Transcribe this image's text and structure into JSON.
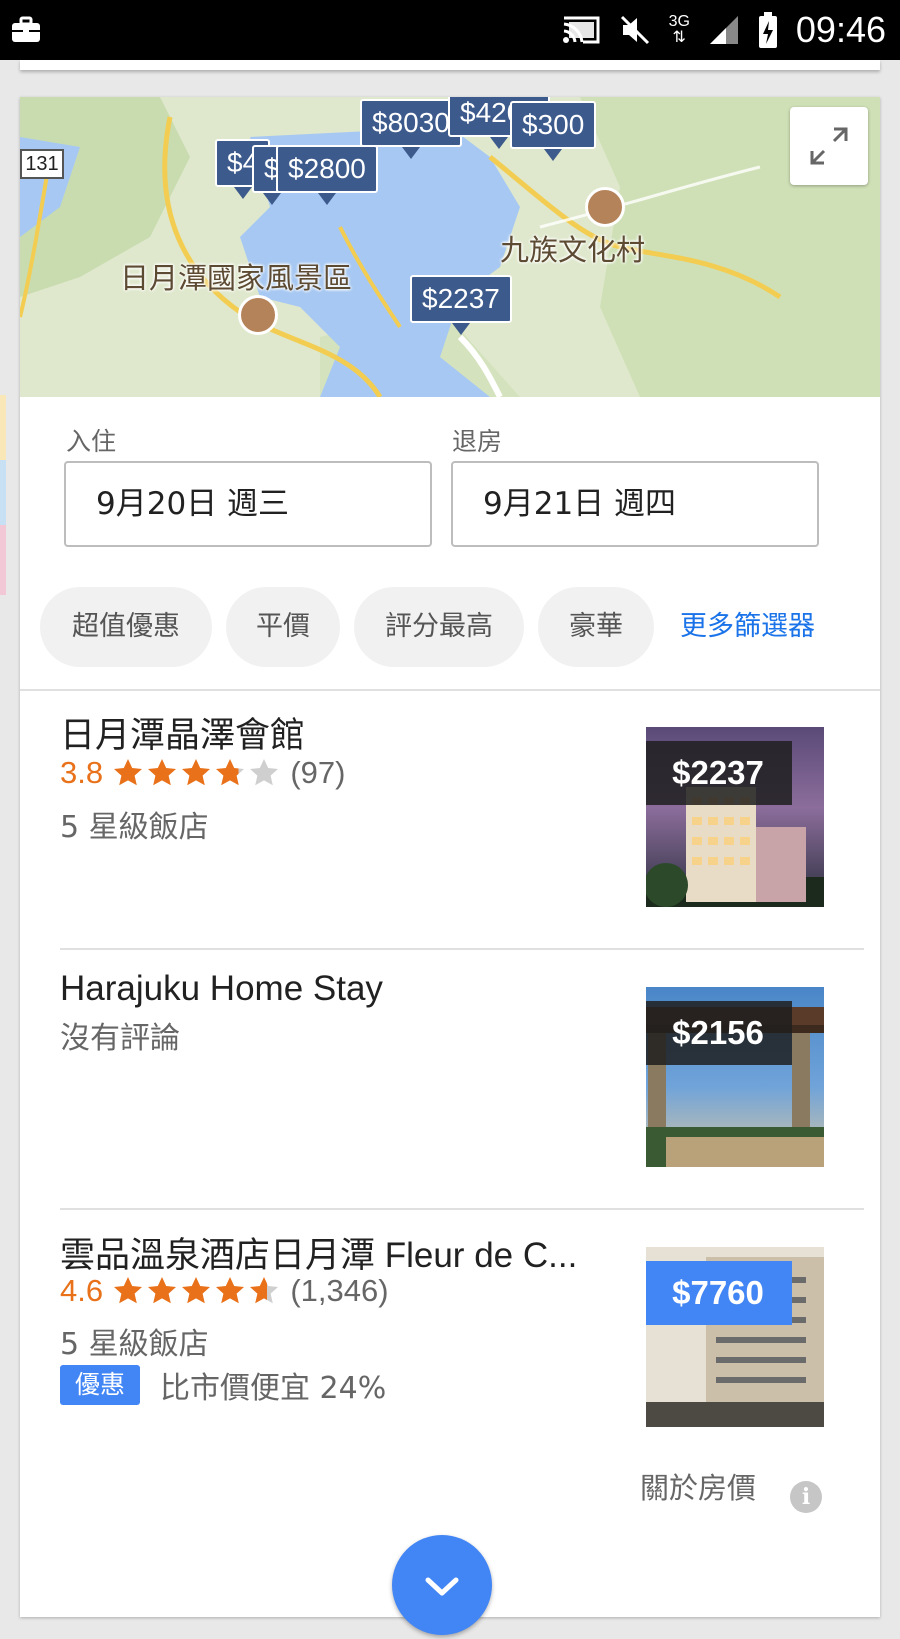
{
  "status_bar": {
    "time": "09:46",
    "network": "3G",
    "icons": [
      "briefcase-icon",
      "cast-icon",
      "mute-icon",
      "signal-icon",
      "battery-charging-icon"
    ]
  },
  "map": {
    "road_number": "131",
    "labels": {
      "park": "日月潭國家風景區",
      "village": "九族文化村"
    },
    "pins": [
      "$8030",
      "$4200",
      "$300",
      "$4",
      "$",
      "$2800",
      "$2237"
    ],
    "expand_icon": "expand-icon"
  },
  "dates": {
    "checkin_label": "入住",
    "checkin_value": "9月20日 週三",
    "checkout_label": "退房",
    "checkout_value": "9月21日 週四"
  },
  "filters": {
    "chips": [
      "超值優惠",
      "平價",
      "評分最高",
      "豪華"
    ],
    "more": "更多篩選器"
  },
  "hotels": [
    {
      "name": "日月潭晶澤會館",
      "rating": "3.8",
      "stars": 3.8,
      "reviews": "(97)",
      "class": "5 星級飯店",
      "price": "$2237",
      "deal": false
    },
    {
      "name": "Harajuku Home Stay",
      "no_reviews": "沒有評論",
      "price": "$2156",
      "deal": false
    },
    {
      "name": "雲品溫泉酒店日月潭 Fleur de C...",
      "rating": "4.6",
      "stars": 4.6,
      "reviews": "(1,346)",
      "class": "5 星級飯店",
      "deal_badge": "優惠",
      "deal_text": "比市價便宜 24%",
      "price": "$7760",
      "deal": true
    }
  ],
  "about_prices": "關於房價",
  "colors": {
    "accent": "#4285f4",
    "rating_orange": "#e8711a",
    "pin_blue": "#3d5a8c"
  }
}
